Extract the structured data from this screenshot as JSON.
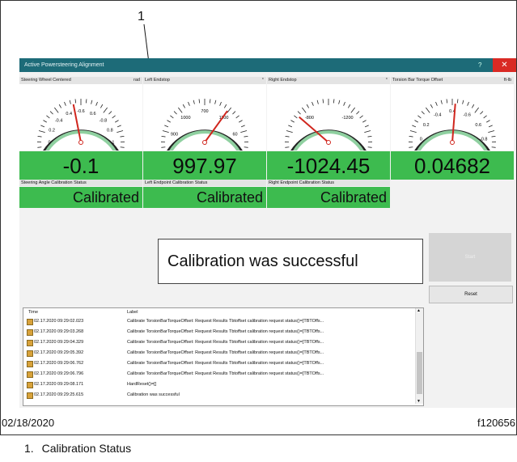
{
  "callout": {
    "number": "1",
    "legend_number": "1.",
    "legend_text": "Calibration Status"
  },
  "window": {
    "title": "Active Powersteering Alignment",
    "help": "?",
    "close": "✕"
  },
  "panels": [
    {
      "label": "Steering Wheel Centered",
      "unit": "rad",
      "value": "-0.1",
      "ticks": [
        "-0.2",
        "0",
        "0.2",
        "-0.4",
        "0.4",
        "-0.6",
        "0.6",
        "-0.8",
        "0.8",
        "-1",
        "1"
      ],
      "needle_fraction": 0.45
    },
    {
      "label": "Left Endstop",
      "unit": "°",
      "value": "997.97",
      "ticks": [
        "800",
        "900",
        "1000",
        "700",
        "1100",
        "60",
        "1200"
      ],
      "needle_fraction": 0.66
    },
    {
      "label": "Right Endstop",
      "unit": "°",
      "value": "-1024.45",
      "ticks": [
        "-1000",
        "-800",
        "-1200",
        "-600"
      ],
      "needle_fraction": 0.28
    },
    {
      "label": "Torsion Bar Torque Offset",
      "unit": "ft-lb",
      "value": "0.04682",
      "ticks": [
        "-0.2",
        "0",
        "0.2",
        "-0.4",
        "0.4",
        "-0.6",
        "0.6",
        "-0.8",
        "0.8"
      ],
      "needle_fraction": 0.52
    }
  ],
  "status_panels": [
    {
      "label": "Steering Angle Calibration Status",
      "value": "Calibrated"
    },
    {
      "label": "Left Endpoint Calibration Status",
      "value": "Calibrated"
    },
    {
      "label": "Right Endpoint Calibration Status",
      "value": "Calibrated"
    }
  ],
  "message": "Calibration was successful",
  "buttons": {
    "disabled": "Start",
    "reset": "Reset"
  },
  "log": {
    "headers": {
      "time": "Time",
      "label": "Label"
    },
    "rows": [
      {
        "time": "02.17.2020 09:29:02.023",
        "label": "Calibrate TorsionBarTorqueOffset: Request Results Tbtoffset calibration request status()=[TBTOffs..."
      },
      {
        "time": "02.17.2020 09:29:03.268",
        "label": "Calibrate TorsionBarTorqueOffset: Request Results Tbtoffset calibration request status()=[TBTOffs..."
      },
      {
        "time": "02.17.2020 09:29:04.329",
        "label": "Calibrate TorsionBarTorqueOffset: Request Results Tbtoffset calibration request status()=[TBTOffs..."
      },
      {
        "time": "02.17.2020 09:29:05.392",
        "label": "Calibrate TorsionBarTorqueOffset: Request Results Tbtoffset calibration request status()=[TBTOffs..."
      },
      {
        "time": "02.17.2020 09:29:06.762",
        "label": "Calibrate TorsionBarTorqueOffset: Request Results Tbtoffset calibration request status()=[TBTOffs..."
      },
      {
        "time": "02.17.2020 09:29:06.796",
        "label": "Calibrate TorsionBarTorqueOffset: Request Results Tbtoffset calibration request status()=[TBTOffs..."
      },
      {
        "time": "02.17.2020 09:29:08.171",
        "label": "HardReset()=[]"
      },
      {
        "time": "02.17.2020 09:29:25.615",
        "label": "Calibration was successful"
      }
    ]
  },
  "footer": {
    "date": "02/18/2020",
    "figure_id": "f120656"
  },
  "colors": {
    "green": "#3dbb4f",
    "titlebar": "#1d6b78",
    "close": "#d92a24",
    "needle": "#d0261e"
  }
}
